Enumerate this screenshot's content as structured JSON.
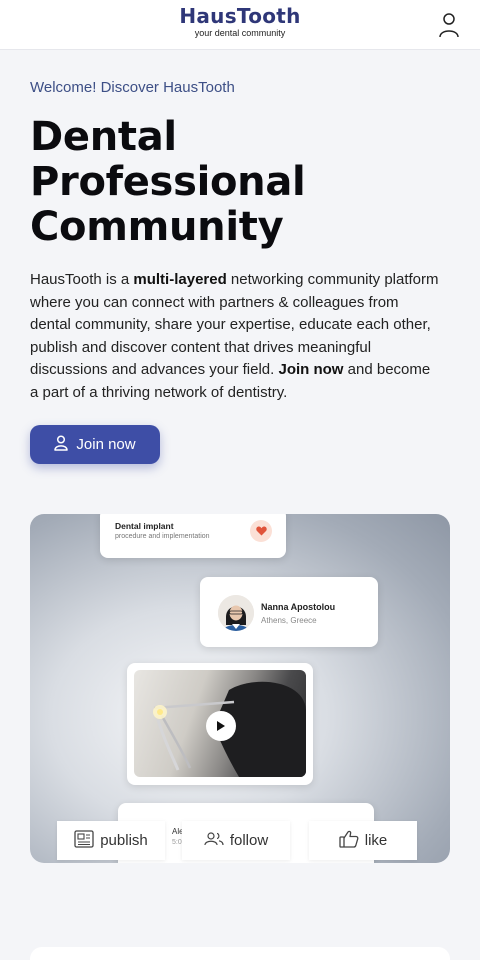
{
  "header": {
    "logo_name": "HausTooth",
    "logo_tagline": "your dental community",
    "user_icon": "user-icon"
  },
  "hero": {
    "welcome": "Welcome! Discover HausTooth",
    "title_lines": [
      "Dental",
      "Professional",
      "Community"
    ],
    "desc": {
      "p1": "HausTooth is a ",
      "b1": "multi-layered",
      "p2": " networking community platform where you can connect with partners & colleagues from dental community, share your expertise, educate each other, publish and discover content that drives meaningful discussions and advances your field. ",
      "b2": "Join now",
      "p3": " and become a part of a thriving network of dentistry."
    },
    "join_label": "Join now"
  },
  "showcase": {
    "implant_title": "Dental implant",
    "implant_sub": "procedure and implementation",
    "person_name": "Nanna Apostolou",
    "person_location": "Athens, Greece",
    "bottom_title": "Ale",
    "bottom_sub": "5:0",
    "actions": {
      "publish": "publish",
      "follow": "follow",
      "like": "like"
    }
  },
  "colors": {
    "brand": "#2f3778",
    "primary_button": "#3e4ea6",
    "welcome_text": "#3d4f86",
    "heart": "#e0533a"
  }
}
